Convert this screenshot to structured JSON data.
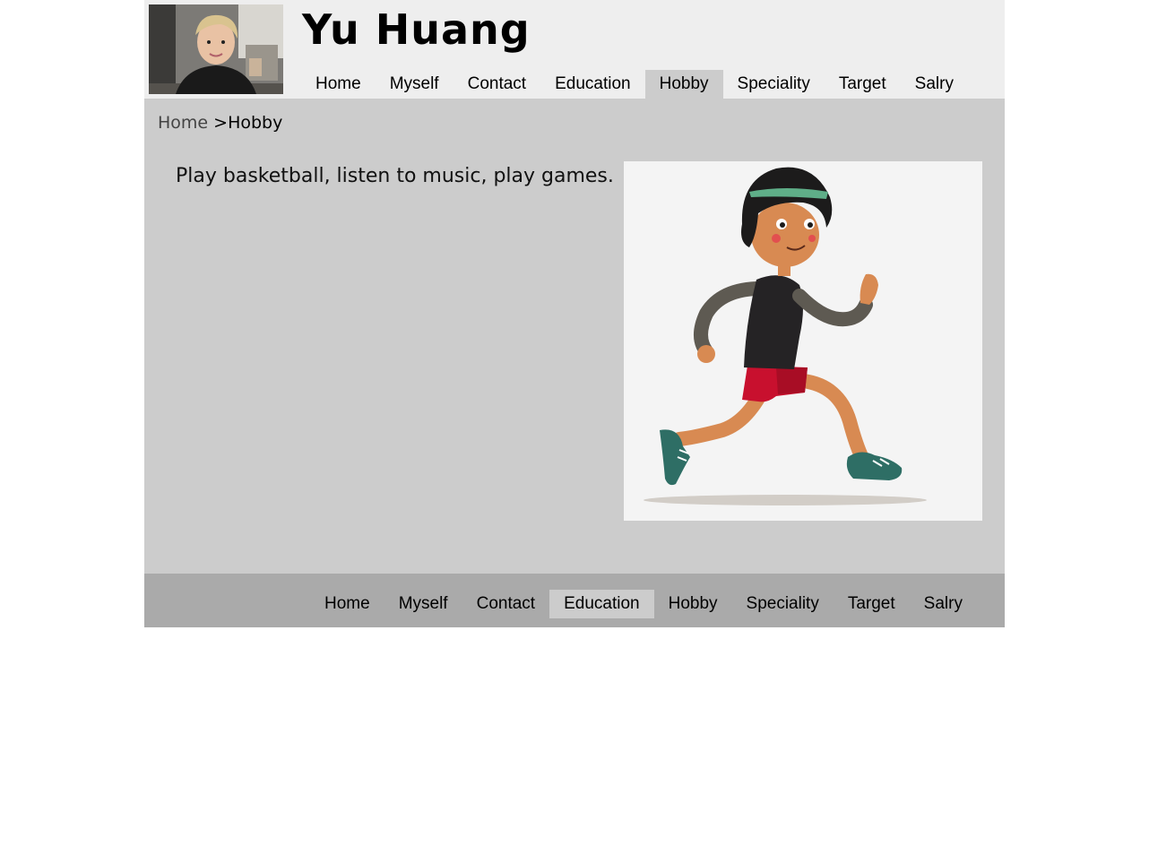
{
  "site": {
    "title": "Yu Huang"
  },
  "nav": {
    "items": [
      {
        "label": "Home"
      },
      {
        "label": "Myself"
      },
      {
        "label": "Contact"
      },
      {
        "label": "Education"
      },
      {
        "label": "Hobby"
      },
      {
        "label": "Speciality"
      },
      {
        "label": "Target"
      },
      {
        "label": "Salry"
      }
    ],
    "top_active": "Hobby",
    "bottom_active": "Education"
  },
  "breadcrumb": {
    "home": "Home",
    "separator": ">",
    "current": "Hobby"
  },
  "content": {
    "hobby_text": "Play basketball, listen to music, play games."
  },
  "colors": {
    "header_bg": "#eeeeee",
    "main_bg": "#cccccc",
    "footer_bg": "#aaaaaa",
    "active_tab_bg": "#cccccc"
  },
  "images": {
    "avatar": "profile-photo",
    "hobby_illustration": "running-person-illustration"
  }
}
